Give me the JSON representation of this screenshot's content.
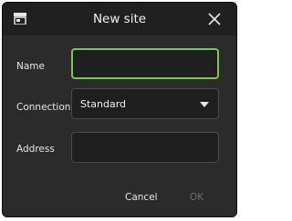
{
  "dialog": {
    "title": "New site",
    "icons": {
      "app": "site-store-icon",
      "close": "close-icon",
      "dropdown": "chevron-down-icon"
    }
  },
  "form": {
    "name_label": "Name",
    "name_value": "",
    "connection_label": "Connection",
    "connection_value": "Standard",
    "address_label": "Address",
    "address_value": ""
  },
  "actions": {
    "cancel_label": "Cancel",
    "ok_label": "OK",
    "ok_enabled": false
  },
  "colors": {
    "focus_border": "#7bc45a",
    "dialog_bg": "#2b2b2b",
    "titlebar_bg": "#202020"
  }
}
